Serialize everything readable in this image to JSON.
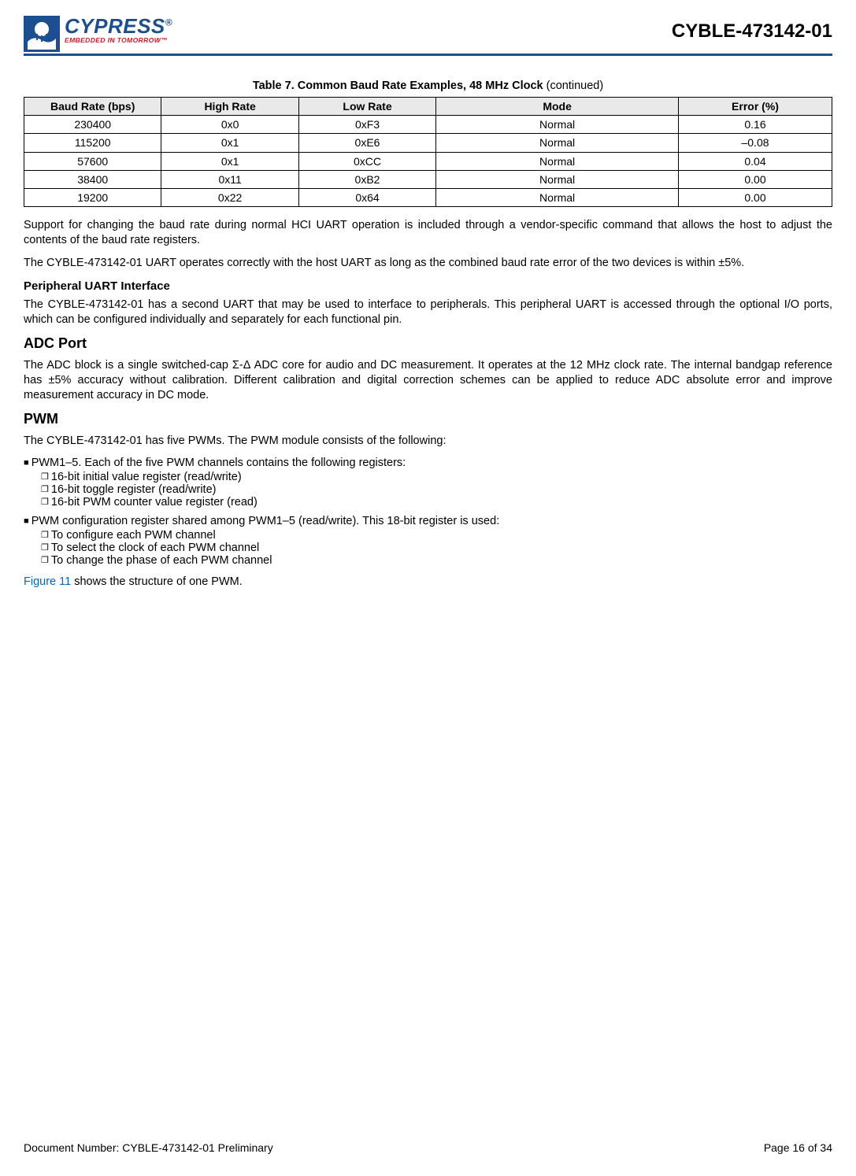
{
  "header": {
    "logo_name": "CYPRESS",
    "logo_tagline": "EMBEDDED IN TOMORROW™",
    "doc_title": "CYBLE-473142-01"
  },
  "table": {
    "caption_prefix": "Table 7.  Common Baud Rate Examples, 48 MHz Clock",
    "caption_suffix": " (continued)",
    "headers": [
      "Baud Rate (bps)",
      "High Rate",
      "Low Rate",
      "Mode",
      "Error (%)"
    ],
    "rows": [
      [
        "230400",
        "0x0",
        "0xF3",
        "Normal",
        "0.16"
      ],
      [
        "115200",
        "0x1",
        "0xE6",
        "Normal",
        "–0.08"
      ],
      [
        "57600",
        "0x1",
        "0xCC",
        "Normal",
        "0.04"
      ],
      [
        "38400",
        "0x11",
        "0xB2",
        "Normal",
        "0.00"
      ],
      [
        "19200",
        "0x22",
        "0x64",
        "Normal",
        "0.00"
      ]
    ]
  },
  "para1": "Support for changing the baud rate during normal HCI UART operation is included through a vendor-specific command that allows the host to adjust the contents of the baud rate registers.",
  "para2": "The CYBLE-473142-01 UART operates correctly with the host UART as long as the combined baud rate error of the two devices is within ±5%.",
  "periph_heading": "Peripheral UART Interface",
  "periph_para": "The CYBLE-473142-01 has a second UART that may be used to interface to peripherals. This peripheral UART is accessed through the optional I/O ports, which can be configured individually and separately for each functional pin.",
  "adc_heading": "ADC Port",
  "adc_para": "The ADC block is a single switched-cap Σ-Δ ADC core for audio and DC measurement. It operates at the 12 MHz clock rate. The internal bandgap reference has ±5% accuracy without calibration. Different calibration and digital correction schemes can be applied to reduce ADC absolute error and improve measurement accuracy in DC mode.",
  "pwm_heading": "PWM",
  "pwm_intro": "The CYBLE-473142-01 has five PWMs. The PWM module consists of the following:",
  "pwm_b1_lead": "PWM1–5. Each of the five PWM channels contains the following registers:",
  "pwm_b1_items": [
    "16-bit initial value register (read/write)",
    "16-bit toggle register (read/write)",
    "16-bit PWM counter value register (read)"
  ],
  "pwm_b2_lead": "PWM configuration register shared among PWM1–5 (read/write). This 18-bit register is used:",
  "pwm_b2_items": [
    "To configure each PWM channel",
    "To select the clock of each PWM channel",
    "To change the phase of each PWM channel"
  ],
  "pwm_figref_link": "Figure 11",
  "pwm_figref_rest": " shows the structure of one PWM.",
  "footer": {
    "left": "Document Number: CYBLE-473142-01 Preliminary",
    "right": "Page 16 of 34"
  }
}
